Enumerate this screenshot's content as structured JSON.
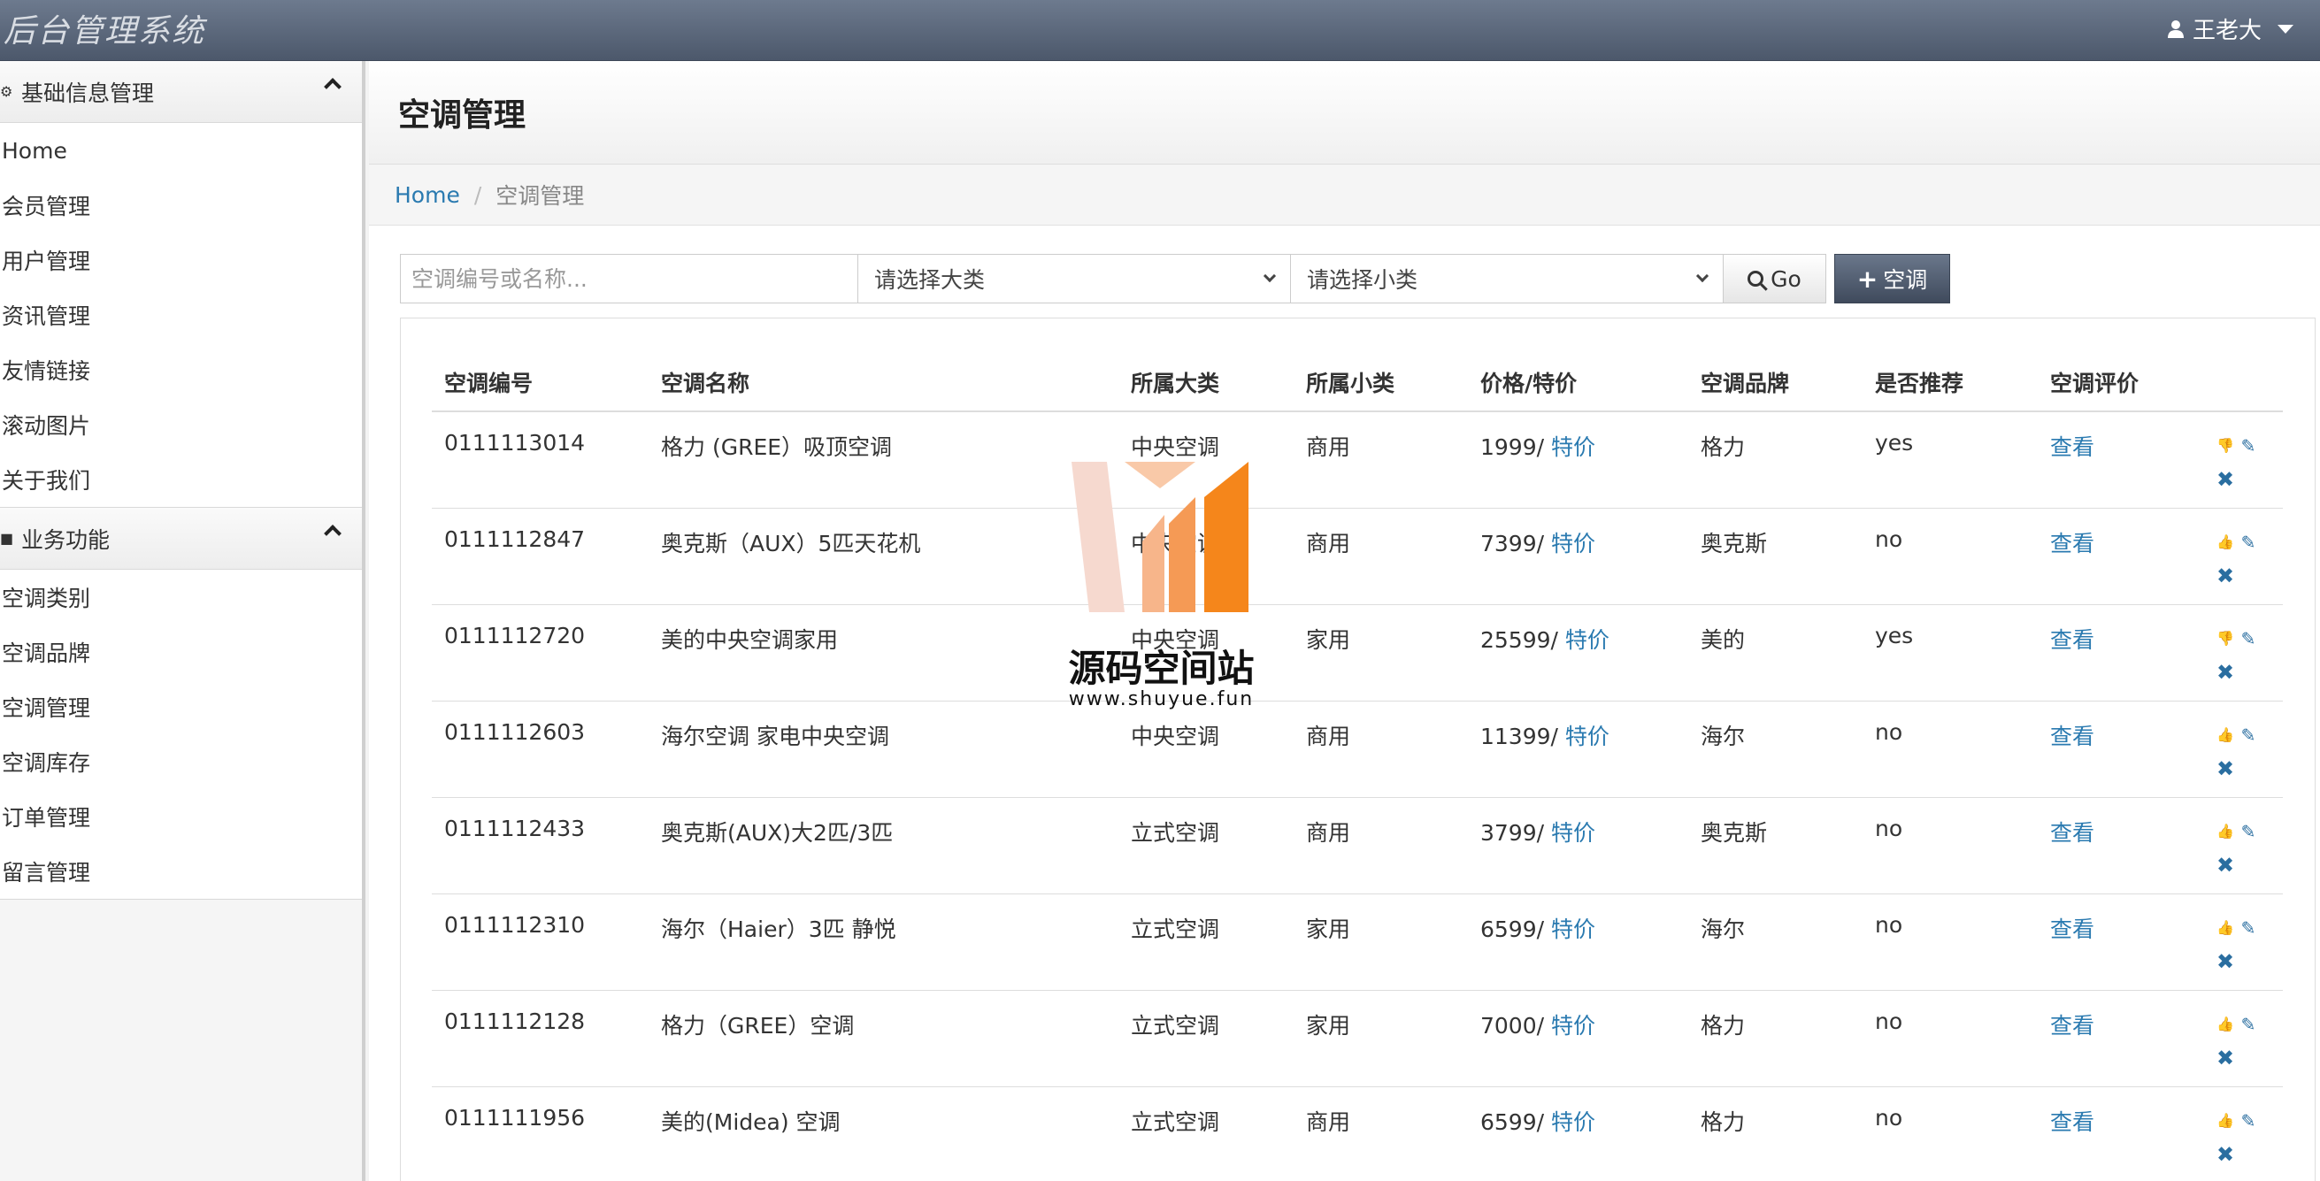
{
  "app": {
    "title": "后台管理系统",
    "user": "王老大"
  },
  "sidebar": {
    "groups": [
      {
        "title": "基础信息管理",
        "items": [
          "Home",
          "会员管理",
          "用户管理",
          "资讯管理",
          "友情链接",
          "滚动图片",
          "关于我们"
        ]
      },
      {
        "title": "业务功能",
        "items": [
          "空调类别",
          "空调品牌",
          "空调管理",
          "空调库存",
          "订单管理",
          "留言管理"
        ]
      }
    ]
  },
  "page": {
    "title": "空调管理"
  },
  "breadcrumb": {
    "home": "Home",
    "current": "空调管理"
  },
  "toolbar": {
    "search_placeholder": "空调编号或名称...",
    "category_select": "请选择大类",
    "subcategory_select": "请选择小类",
    "go_label": "Go",
    "add_label": "空调"
  },
  "table": {
    "headers": [
      "空调编号",
      "空调名称",
      "所属大类",
      "所属小类",
      "价格/特价",
      "空调品牌",
      "是否推荐",
      "空调评价"
    ],
    "special_label": "特价",
    "view_label": "查看",
    "rows": [
      {
        "id": "0111113014",
        "name": "格力 (GREE）吸顶空调",
        "cat": "中央空调",
        "sub": "商用",
        "price": "1999/",
        "brand": "格力",
        "rec": "yes",
        "thumb": "down"
      },
      {
        "id": "0111112847",
        "name": "奥克斯（AUX）5匹天花机",
        "cat": "中央空调",
        "sub": "商用",
        "price": "7399/",
        "brand": "奥克斯",
        "rec": "no",
        "thumb": "up"
      },
      {
        "id": "0111112720",
        "name": "美的中央空调家用",
        "cat": "中央空调",
        "sub": "家用",
        "price": "25599/",
        "brand": "美的",
        "rec": "yes",
        "thumb": "down"
      },
      {
        "id": "0111112603",
        "name": "海尔空调 家电中央空调",
        "cat": "中央空调",
        "sub": "商用",
        "price": "11399/",
        "brand": "海尔",
        "rec": "no",
        "thumb": "up"
      },
      {
        "id": "0111112433",
        "name": "奥克斯(AUX)大2匹/3匹",
        "cat": "立式空调",
        "sub": "商用",
        "price": "3799/",
        "brand": "奥克斯",
        "rec": "no",
        "thumb": "up"
      },
      {
        "id": "0111112310",
        "name": "海尔（Haier）3匹 静悦",
        "cat": "立式空调",
        "sub": "家用",
        "price": "6599/",
        "brand": "海尔",
        "rec": "no",
        "thumb": "up"
      },
      {
        "id": "0111112128",
        "name": "格力（GREE）空调",
        "cat": "立式空调",
        "sub": "家用",
        "price": "7000/",
        "brand": "格力",
        "rec": "no",
        "thumb": "up"
      },
      {
        "id": "0111111956",
        "name": "美的(Midea) 空调",
        "cat": "立式空调",
        "sub": "商用",
        "price": "6599/",
        "brand": "格力",
        "rec": "no",
        "thumb": "up"
      }
    ]
  },
  "watermark": {
    "title": "源码空间站",
    "url": "www.shuyue.fun"
  },
  "colors": {
    "navbar": "#56627a",
    "link": "#2a7ab0",
    "accent": "#f58a1f"
  }
}
